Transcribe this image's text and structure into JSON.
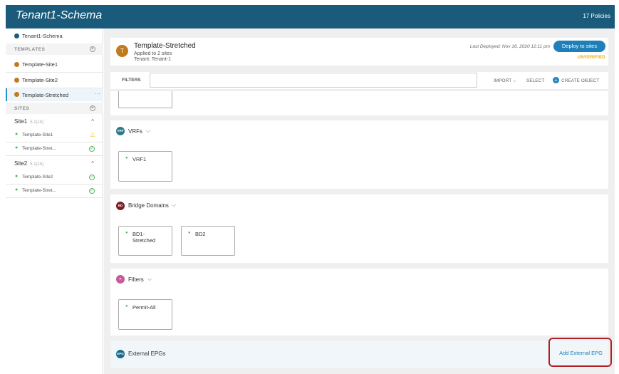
{
  "header": {
    "title": "Tenant1-Schema",
    "policies": "17 Policies"
  },
  "sidebar": {
    "schema_label": "Tenant1-Schema",
    "templates_section": "TEMPLATES",
    "templates": [
      {
        "label": "Template-Site1"
      },
      {
        "label": "Template-Site2"
      },
      {
        "label": "Template-Stretched",
        "more": "···"
      }
    ],
    "sites_section": "SITES",
    "sites": [
      {
        "name": "Site1",
        "version": "5.1(1h)",
        "templates": [
          {
            "label": "Template-Site1",
            "status": "warning"
          },
          {
            "label": "Template-Stret...",
            "status": "ok"
          }
        ]
      },
      {
        "name": "Site2",
        "version": "5.1(1h)",
        "templates": [
          {
            "label": "Template-Site2",
            "status": "ok"
          },
          {
            "label": "Template-Stret...",
            "status": "ok"
          }
        ]
      }
    ]
  },
  "template": {
    "avatar": "T",
    "name": "Template-Stretched",
    "applied": "Applied to 2 sites",
    "tenant": "Tenant: Tenant-1",
    "last_deployed": "Last Deployed: Nov 16, 2020 12:11 pm",
    "deploy_button": "Deploy to sites",
    "status": "UNVERIFIED"
  },
  "toolbar": {
    "filters_label": "FILTERS",
    "filter_value": "",
    "import": "IMPORT ⌵",
    "select": "SELECT",
    "create": "CREATE OBJECT"
  },
  "sections": {
    "vrfs": {
      "icon": "VRF",
      "title": "VRFs",
      "objects": [
        "VRF1"
      ]
    },
    "bds": {
      "icon": "BD",
      "title": "Bridge Domains",
      "objects": [
        "BD1-\nStretched",
        "BD2"
      ]
    },
    "filters": {
      "icon": "F",
      "title": "Filters",
      "objects": [
        "Permit-All"
      ]
    },
    "external_epgs": {
      "icon": "EPG",
      "title": "External EPGs",
      "add": "Add External EPG"
    }
  },
  "colors": {
    "header_bg": "#1a5a7a",
    "accent": "#1e7fb9",
    "vrf_icon": "#2b7a8a",
    "bd_icon": "#7a1e22",
    "filter_icon": "#c75a9a",
    "epg_icon": "#1a6a8a",
    "highlight": "#b01e24",
    "warning": "#f0b400",
    "ok": "#57b45a"
  }
}
